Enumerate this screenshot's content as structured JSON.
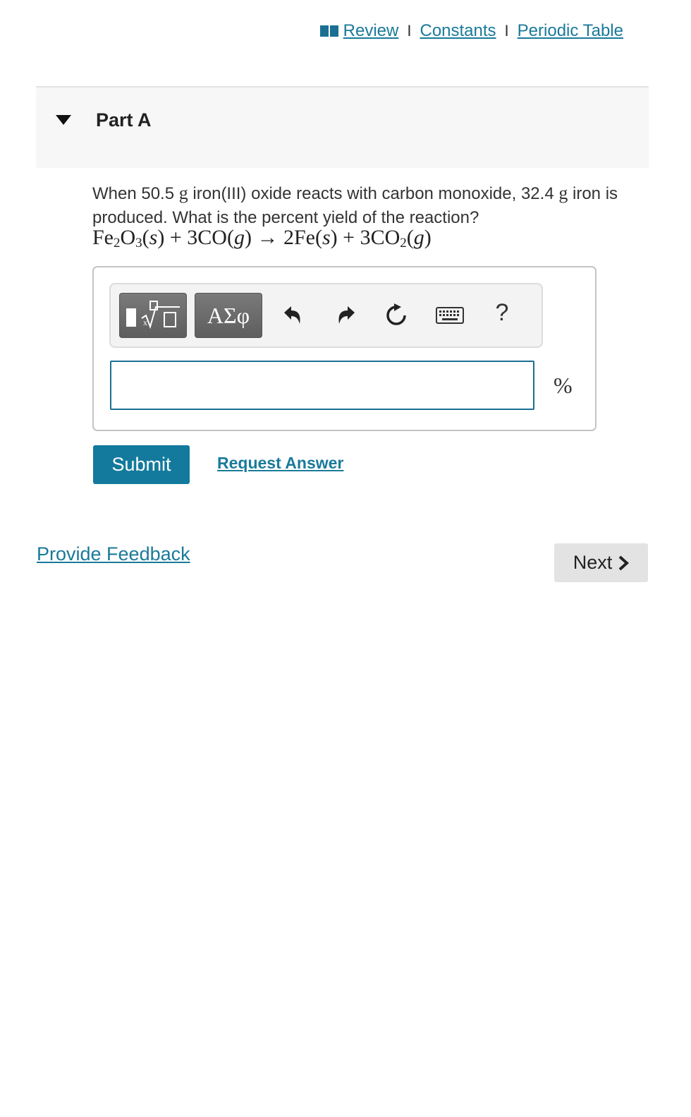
{
  "top_links": {
    "review": "Review",
    "separator": "I",
    "constants": "Constants",
    "periodic_table": "Periodic Table"
  },
  "part": {
    "title": "Part A"
  },
  "question": {
    "text_1": "When 50.5 ",
    "unit_g": "g",
    "text_2": " iron(III) oxide reacts with carbon monoxide, 32.4 ",
    "text_3": " iron is produced. What is the percent yield of the reaction?"
  },
  "equation": {
    "reactant_1": "Fe",
    "sub_2": "2",
    "o": "O",
    "sub_3": "3",
    "state_s": "s",
    "plus": " + ",
    "co": "3CO",
    "state_g": "g",
    "arrow": " → ",
    "product_1": "2Fe",
    "co2": "3CO",
    "open": "(",
    "close": ")"
  },
  "toolbar": {
    "greek_label": "ΑΣφ",
    "help_label": "?"
  },
  "answer": {
    "value": "",
    "unit": "%"
  },
  "actions": {
    "submit_label": "Submit",
    "request_answer_label": "Request Answer"
  },
  "footer": {
    "feedback_label": "Provide Feedback",
    "next_label": "Next"
  },
  "colors": {
    "link": "#1a7a9a",
    "submit_bg": "#137a9d",
    "next_bg": "#e3e3e3"
  }
}
